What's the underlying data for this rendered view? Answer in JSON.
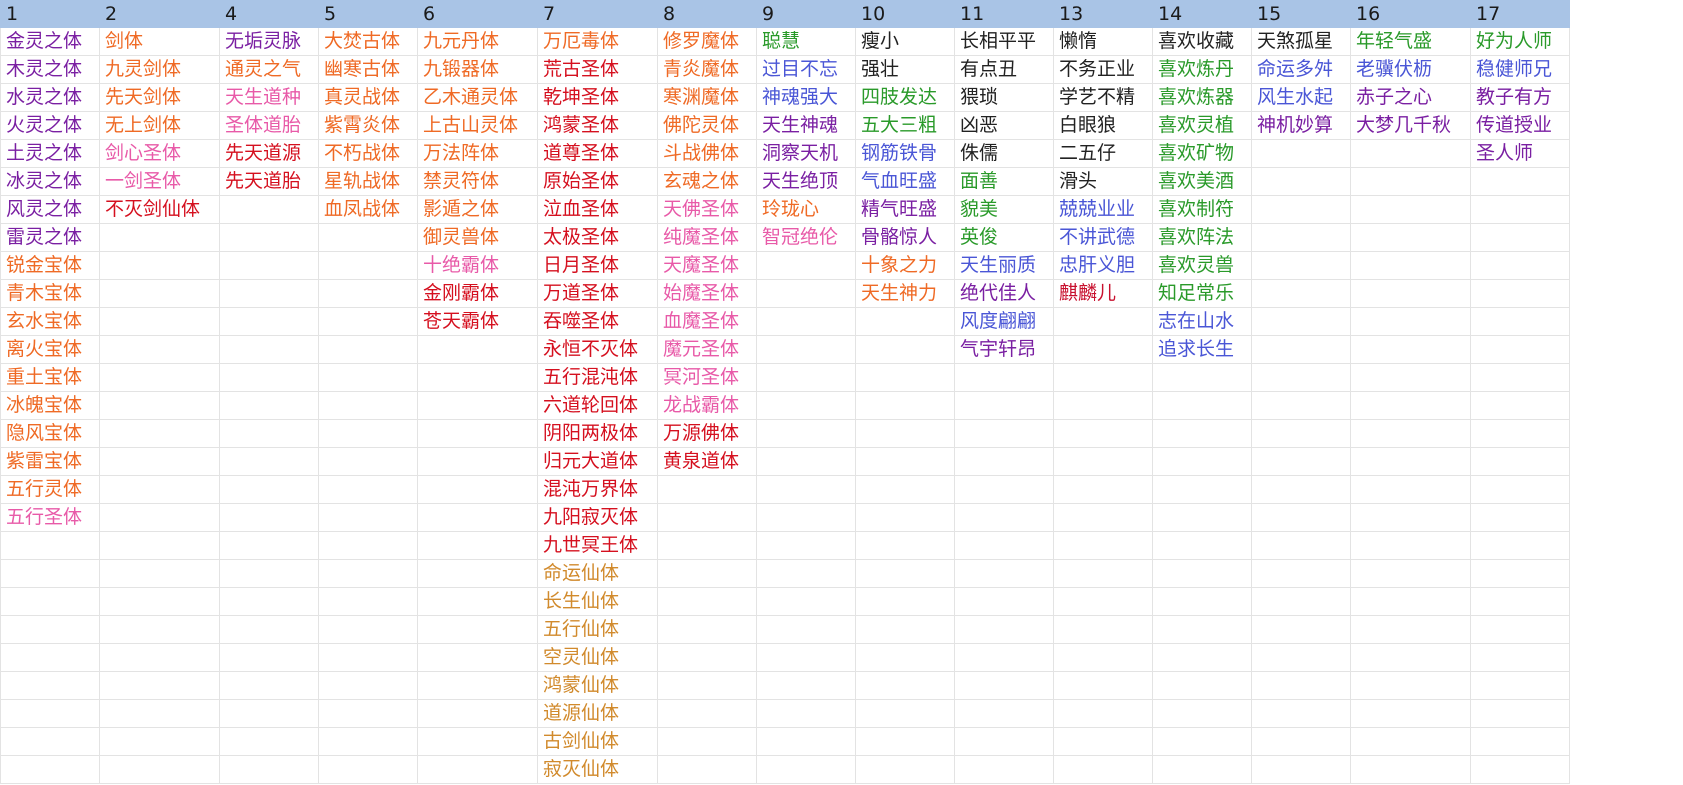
{
  "colors": {
    "purple": "#7a1fa2",
    "orange": "#ef6a25",
    "pink": "#e85aa8",
    "red": "#d5101f",
    "gold": "#d18a2c",
    "green": "#2a9a2a",
    "blue": "#4a56d6",
    "black": "#222222",
    "header_bg": "#a9c4e6"
  },
  "header": [
    "1",
    "2",
    "4",
    "5",
    "6",
    "7",
    "8",
    "9",
    "10",
    "11",
    "13",
    "14",
    "15",
    "16",
    "17"
  ],
  "columns": [
    [
      {
        "t": "金灵之体",
        "c": "purple"
      },
      {
        "t": "木灵之体",
        "c": "purple"
      },
      {
        "t": "水灵之体",
        "c": "purple"
      },
      {
        "t": "火灵之体",
        "c": "purple"
      },
      {
        "t": "土灵之体",
        "c": "purple"
      },
      {
        "t": "冰灵之体",
        "c": "purple"
      },
      {
        "t": "风灵之体",
        "c": "purple"
      },
      {
        "t": "雷灵之体",
        "c": "purple"
      },
      {
        "t": "锐金宝体",
        "c": "orange"
      },
      {
        "t": "青木宝体",
        "c": "orange"
      },
      {
        "t": "玄水宝体",
        "c": "orange"
      },
      {
        "t": "离火宝体",
        "c": "orange"
      },
      {
        "t": "重土宝体",
        "c": "orange"
      },
      {
        "t": "冰魄宝体",
        "c": "orange"
      },
      {
        "t": "隐风宝体",
        "c": "orange"
      },
      {
        "t": "紫雷宝体",
        "c": "orange"
      },
      {
        "t": "五行灵体",
        "c": "orange"
      },
      {
        "t": "五行圣体",
        "c": "pink"
      }
    ],
    [
      {
        "t": "剑体",
        "c": "orange"
      },
      {
        "t": "九灵剑体",
        "c": "orange"
      },
      {
        "t": "先天剑体",
        "c": "orange"
      },
      {
        "t": "无上剑体",
        "c": "orange"
      },
      {
        "t": "剑心圣体",
        "c": "pink"
      },
      {
        "t": "一剑圣体",
        "c": "pink"
      },
      {
        "t": "不灭剑仙体",
        "c": "red"
      }
    ],
    [
      {
        "t": "无垢灵脉",
        "c": "purple"
      },
      {
        "t": "通灵之气",
        "c": "orange"
      },
      {
        "t": "天生道种",
        "c": "pink"
      },
      {
        "t": "圣体道胎",
        "c": "pink"
      },
      {
        "t": "先天道源",
        "c": "red"
      },
      {
        "t": "先天道胎",
        "c": "red"
      }
    ],
    [
      {
        "t": "大焚古体",
        "c": "orange"
      },
      {
        "t": "幽寒古体",
        "c": "orange"
      },
      {
        "t": "真灵战体",
        "c": "orange"
      },
      {
        "t": "紫霄炎体",
        "c": "orange"
      },
      {
        "t": "不朽战体",
        "c": "orange"
      },
      {
        "t": "星轨战体",
        "c": "orange"
      },
      {
        "t": "血凤战体",
        "c": "orange"
      }
    ],
    [
      {
        "t": "九元丹体",
        "c": "orange"
      },
      {
        "t": "九锻器体",
        "c": "orange"
      },
      {
        "t": "乙木通灵体",
        "c": "orange"
      },
      {
        "t": "上古山灵体",
        "c": "orange"
      },
      {
        "t": "万法阵体",
        "c": "orange"
      },
      {
        "t": "禁灵符体",
        "c": "orange"
      },
      {
        "t": "影遁之体",
        "c": "orange"
      },
      {
        "t": "御灵兽体",
        "c": "orange"
      },
      {
        "t": "十绝霸体",
        "c": "pink"
      },
      {
        "t": "金刚霸体",
        "c": "red"
      },
      {
        "t": "苍天霸体",
        "c": "red"
      }
    ],
    [
      {
        "t": "万厄毒体",
        "c": "orange"
      },
      {
        "t": "荒古圣体",
        "c": "red"
      },
      {
        "t": "乾坤圣体",
        "c": "red"
      },
      {
        "t": "鸿蒙圣体",
        "c": "red"
      },
      {
        "t": "道尊圣体",
        "c": "red"
      },
      {
        "t": "原始圣体",
        "c": "red"
      },
      {
        "t": "泣血圣体",
        "c": "red"
      },
      {
        "t": "太极圣体",
        "c": "red"
      },
      {
        "t": "日月圣体",
        "c": "red"
      },
      {
        "t": "万道圣体",
        "c": "red"
      },
      {
        "t": "吞噬圣体",
        "c": "red"
      },
      {
        "t": "永恒不灭体",
        "c": "red"
      },
      {
        "t": "五行混沌体",
        "c": "red"
      },
      {
        "t": "六道轮回体",
        "c": "red"
      },
      {
        "t": "阴阳两极体",
        "c": "red"
      },
      {
        "t": "归元大道体",
        "c": "red"
      },
      {
        "t": "混沌万界体",
        "c": "red"
      },
      {
        "t": "九阳寂灭体",
        "c": "red"
      },
      {
        "t": "九世冥王体",
        "c": "red"
      },
      {
        "t": "命运仙体",
        "c": "gold"
      },
      {
        "t": "长生仙体",
        "c": "gold"
      },
      {
        "t": "五行仙体",
        "c": "gold"
      },
      {
        "t": "空灵仙体",
        "c": "gold"
      },
      {
        "t": "鸿蒙仙体",
        "c": "gold"
      },
      {
        "t": "道源仙体",
        "c": "gold"
      },
      {
        "t": "古剑仙体",
        "c": "gold"
      },
      {
        "t": "寂灭仙体",
        "c": "gold"
      }
    ],
    [
      {
        "t": "修罗魔体",
        "c": "orange"
      },
      {
        "t": "青炎魔体",
        "c": "orange"
      },
      {
        "t": "寒渊魔体",
        "c": "orange"
      },
      {
        "t": "佛陀灵体",
        "c": "orange"
      },
      {
        "t": "斗战佛体",
        "c": "orange"
      },
      {
        "t": "玄魂之体",
        "c": "orange"
      },
      {
        "t": "天佛圣体",
        "c": "pink"
      },
      {
        "t": "纯魔圣体",
        "c": "pink"
      },
      {
        "t": "天魔圣体",
        "c": "pink"
      },
      {
        "t": "始魔圣体",
        "c": "pink"
      },
      {
        "t": "血魔圣体",
        "c": "pink"
      },
      {
        "t": "魔元圣体",
        "c": "pink"
      },
      {
        "t": "冥河圣体",
        "c": "pink"
      },
      {
        "t": "龙战霸体",
        "c": "pink"
      },
      {
        "t": "万源佛体",
        "c": "red"
      },
      {
        "t": "黄泉道体",
        "c": "red"
      }
    ],
    [
      {
        "t": "聪慧",
        "c": "green"
      },
      {
        "t": "过目不忘",
        "c": "blue"
      },
      {
        "t": "神魂强大",
        "c": "blue"
      },
      {
        "t": "天生神魂",
        "c": "purple"
      },
      {
        "t": "洞察天机",
        "c": "purple"
      },
      {
        "t": "天生绝顶",
        "c": "purple"
      },
      {
        "t": "玲珑心",
        "c": "orange"
      },
      {
        "t": "智冠绝伦",
        "c": "pink"
      }
    ],
    [
      {
        "t": "瘦小",
        "c": "black"
      },
      {
        "t": "强壮",
        "c": "black"
      },
      {
        "t": "四肢发达",
        "c": "green"
      },
      {
        "t": "五大三粗",
        "c": "green"
      },
      {
        "t": "钢筋铁骨",
        "c": "blue"
      },
      {
        "t": "气血旺盛",
        "c": "blue"
      },
      {
        "t": "精气旺盛",
        "c": "purple"
      },
      {
        "t": "骨骼惊人",
        "c": "purple"
      },
      {
        "t": "十象之力",
        "c": "orange"
      },
      {
        "t": "天生神力",
        "c": "orange"
      }
    ],
    [
      {
        "t": "长相平平",
        "c": "black"
      },
      {
        "t": "有点丑",
        "c": "black"
      },
      {
        "t": "猥琐",
        "c": "black"
      },
      {
        "t": "凶恶",
        "c": "black"
      },
      {
        "t": "侏儒",
        "c": "black"
      },
      {
        "t": "面善",
        "c": "green"
      },
      {
        "t": "貌美",
        "c": "green"
      },
      {
        "t": "英俊",
        "c": "green"
      },
      {
        "t": "天生丽质",
        "c": "blue"
      },
      {
        "t": "绝代佳人",
        "c": "purple"
      },
      {
        "t": "风度翩翩",
        "c": "blue"
      },
      {
        "t": "气宇轩昂",
        "c": "purple"
      }
    ],
    [
      {
        "t": "懒惰",
        "c": "black"
      },
      {
        "t": "不务正业",
        "c": "black"
      },
      {
        "t": "学艺不精",
        "c": "black"
      },
      {
        "t": "白眼狼",
        "c": "black"
      },
      {
        "t": "二五仔",
        "c": "black"
      },
      {
        "t": "滑头",
        "c": "black"
      },
      {
        "t": "兢兢业业",
        "c": "blue"
      },
      {
        "t": "不讲武德",
        "c": "blue"
      },
      {
        "t": "忠肝义胆",
        "c": "blue"
      },
      {
        "t": "麒麟儿",
        "c": "dred"
      }
    ],
    [
      {
        "t": "喜欢收藏",
        "c": "black"
      },
      {
        "t": "喜欢炼丹",
        "c": "green"
      },
      {
        "t": "喜欢炼器",
        "c": "green"
      },
      {
        "t": "喜欢灵植",
        "c": "green"
      },
      {
        "t": "喜欢矿物",
        "c": "green"
      },
      {
        "t": "喜欢美酒",
        "c": "green"
      },
      {
        "t": "喜欢制符",
        "c": "green"
      },
      {
        "t": "喜欢阵法",
        "c": "green"
      },
      {
        "t": "喜欢灵兽",
        "c": "green"
      },
      {
        "t": "知足常乐",
        "c": "green"
      },
      {
        "t": "志在山水",
        "c": "blue"
      },
      {
        "t": "追求长生",
        "c": "blue"
      }
    ],
    [
      {
        "t": "天煞孤星",
        "c": "black"
      },
      {
        "t": "命运多舛",
        "c": "blue"
      },
      {
        "t": "风生水起",
        "c": "blue"
      },
      {
        "t": "神机妙算",
        "c": "purple"
      }
    ],
    [
      {
        "t": "年轻气盛",
        "c": "green"
      },
      {
        "t": "老骥伏枥",
        "c": "blue"
      },
      {
        "t": "赤子之心",
        "c": "purple"
      },
      {
        "t": "大梦几千秋",
        "c": "purple"
      }
    ],
    [
      {
        "t": "好为人师",
        "c": "green"
      },
      {
        "t": "稳健师兄",
        "c": "blue"
      },
      {
        "t": "教子有方",
        "c": "purple"
      },
      {
        "t": "传道授业",
        "c": "purple"
      },
      {
        "t": "圣人师",
        "c": "purple"
      }
    ]
  ]
}
